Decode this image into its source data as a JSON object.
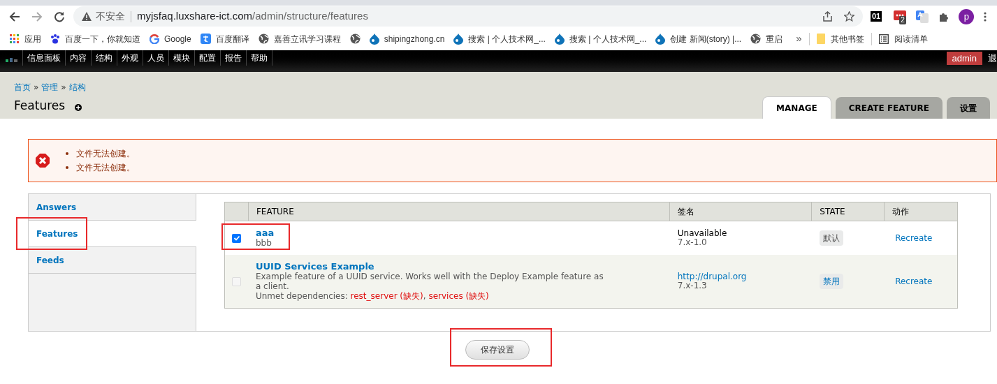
{
  "browser": {
    "security_label": "不安全",
    "url_host": "myjsfaq.luxshare-ict.com",
    "url_path": "/admin/structure/features",
    "extension_badge": "2",
    "extension_text": "01",
    "profile_initial": "p",
    "bookmarks": [
      {
        "label": "应用",
        "kind": "apps"
      },
      {
        "label": "百度一下，你就知道",
        "kind": "paw"
      },
      {
        "label": "Google",
        "kind": "google"
      },
      {
        "label": "百度翻译",
        "kind": "translate"
      },
      {
        "label": "嘉善立讯学习课程",
        "kind": "globe"
      },
      {
        "kind": "globe"
      },
      {
        "label": "shipingzhong.cn",
        "kind": "drop"
      },
      {
        "label": "搜索 | 个人技术网_...",
        "kind": "drop"
      },
      {
        "label": "搜索 | 个人技术网_...",
        "kind": "drop"
      },
      {
        "label": "创建 新闻(story) |...",
        "kind": "drop"
      },
      {
        "label": "重启",
        "kind": "globe"
      }
    ],
    "more": "»",
    "other_bookmarks": "其他书签",
    "reading_list": "阅读清单"
  },
  "admin_menu": {
    "items": [
      "信息面板",
      "内容",
      "结构",
      "外观",
      "人员",
      "模块",
      "配置",
      "报告",
      "帮助"
    ],
    "user": "admin",
    "logout": "退"
  },
  "header": {
    "breadcrumb": [
      "首页",
      "管理",
      "结构"
    ],
    "breadcrumb_separator": "»",
    "title": "Features",
    "tabs": [
      {
        "label": "MANAGE",
        "selected": true
      },
      {
        "label": "CREATE FEATURE",
        "selected": false
      },
      {
        "label": "设置",
        "selected": false
      }
    ]
  },
  "messages": [
    "文件无法创建。",
    "文件无法创建。"
  ],
  "vertical_tabs": [
    {
      "label": "Answers",
      "selected": false,
      "highlighted": false
    },
    {
      "label": "Features",
      "selected": true,
      "highlighted": true
    },
    {
      "label": "Feeds",
      "selected": false,
      "highlighted": false
    }
  ],
  "table": {
    "columns": [
      "FEATURE",
      "签名",
      "STATE",
      "动作"
    ],
    "rows": [
      {
        "checked": true,
        "disabled": false,
        "highlighted": true,
        "name": "aaa",
        "description": "bbb",
        "dependencies": [],
        "signature": "Unavailable",
        "signature_link": false,
        "version": "7.x-1.0",
        "state": "默认",
        "action": "Recreate"
      },
      {
        "checked": false,
        "disabled": true,
        "highlighted": false,
        "name": "UUID Services Example",
        "description": "Example feature of a UUID service. Works well with the Deploy Example feature as a client.",
        "dependencies": [
          {
            "text": "Unmet dependencies: ",
            "missing": false
          },
          {
            "text": "rest_server (缺失)",
            "missing": true
          },
          {
            "text": ", ",
            "missing": false
          },
          {
            "text": "services (缺失)",
            "missing": true
          }
        ],
        "signature": "http://drupal.org",
        "signature_link": true,
        "version": "7.x-1.3",
        "state": "禁用",
        "action": "Recreate"
      }
    ]
  },
  "save_button": {
    "label": "保存设置",
    "highlighted": true
  }
}
